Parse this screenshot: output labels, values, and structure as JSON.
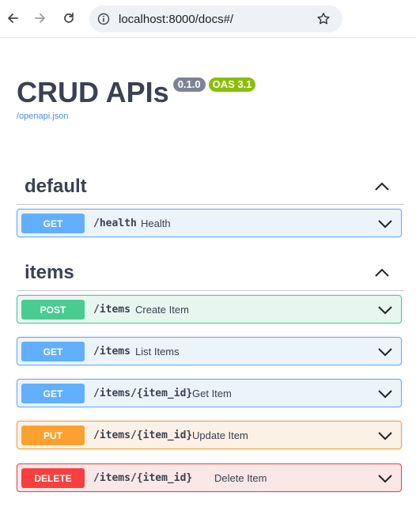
{
  "browser": {
    "url": "localhost:8000/docs#/"
  },
  "info": {
    "title": "CRUD APIs",
    "version": "0.1.0",
    "oas": "OAS 3.1",
    "spec_link": "/openapi.json"
  },
  "tags": [
    {
      "name": "default",
      "operations": [
        {
          "method": "GET",
          "path": "/health",
          "summary": "Health"
        }
      ]
    },
    {
      "name": "items",
      "operations": [
        {
          "method": "POST",
          "path": "/items",
          "summary": "Create Item"
        },
        {
          "method": "GET",
          "path": "/items",
          "summary": "List Items"
        },
        {
          "method": "GET",
          "path": "/items/{item_id}",
          "summary": "Get Item"
        },
        {
          "method": "PUT",
          "path": "/items/{item_id}",
          "summary": "Update Item"
        },
        {
          "method": "DELETE",
          "path": "/items/{item_id}",
          "summary": "Delete Item"
        }
      ]
    }
  ],
  "colors": {
    "get": "#61affe",
    "post": "#49cc90",
    "put": "#fca130",
    "delete": "#f93e3e",
    "version_badge": "#7d8492",
    "oas_badge": "#89bf04"
  }
}
